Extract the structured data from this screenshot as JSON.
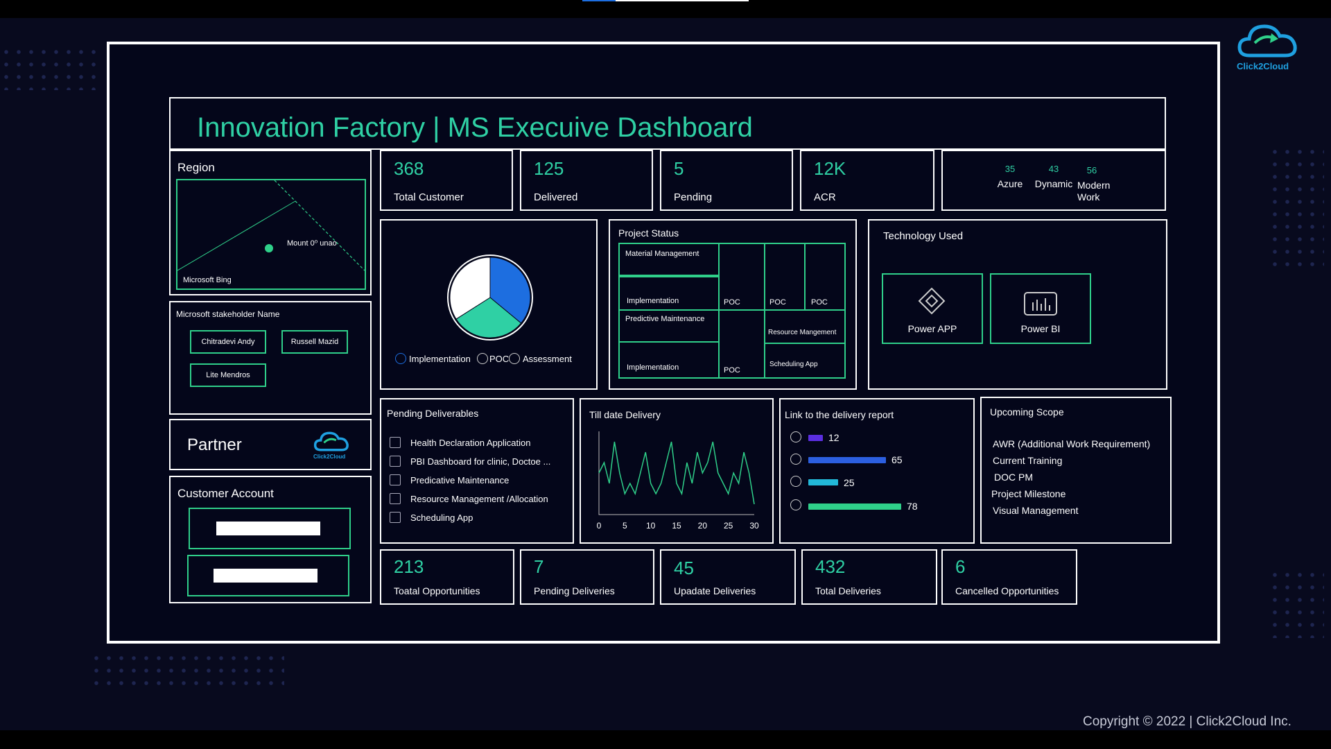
{
  "logo": {
    "text": "Click2Cloud"
  },
  "title": "Innovation Factory | MS Execuive Dashboard",
  "region": {
    "title": "Region",
    "marker_label": "Mount 0⁰ unao",
    "map_label": "Microsoft Bing"
  },
  "stakeholders": {
    "title": "Microsoft stakeholder Name",
    "names": [
      "Chitradevi Andy",
      "Russell Mazid",
      "Lite Mendros"
    ]
  },
  "partner": {
    "title": "Partner",
    "logo_text": "Click2Cloud"
  },
  "customer_account": {
    "title": "Customer Account"
  },
  "kpis_top": [
    {
      "value": "368",
      "label": "Total Customer"
    },
    {
      "value": "125",
      "label": "Delivered"
    },
    {
      "value": "5",
      "label": "Pending"
    },
    {
      "value": "12K",
      "label": "ACR"
    }
  ],
  "tech_counts": [
    {
      "value": "35",
      "label": "Azure"
    },
    {
      "value": "43",
      "label": "Dynamic"
    },
    {
      "value": "56",
      "label": "Modern Work"
    }
  ],
  "pie": {
    "legend": [
      "Implementation",
      "POC",
      "Assessment"
    ],
    "colors": [
      "#1d6ee0",
      "#2fd0a4",
      "#ffffff"
    ]
  },
  "project_status": {
    "title": "Project Status",
    "cells": {
      "material": "Material Management",
      "impl1": "Implementation",
      "poc1": "POC",
      "poc2": "POC",
      "poc3": "POC",
      "predictive": "Predictive Maintenance",
      "impl2": "Implementation",
      "poc4": "POC",
      "resource": "Resource Mangement",
      "scheduling": "Scheduling App"
    }
  },
  "technology": {
    "title": "Technology Used",
    "items": [
      "Power APP",
      "Power BI"
    ]
  },
  "pending_deliverables": {
    "title": "Pending Deliverables",
    "items": [
      "Health Declaration Application",
      "PBI Dashboard for clinic, Doctoe ...",
      "Predicative Maintenance",
      "Resource Management /Allocation",
      "Scheduling App"
    ]
  },
  "till_date": {
    "title": "Till date Delivery"
  },
  "delivery_report": {
    "title": "Link to the delivery report",
    "bars": [
      {
        "value": 12,
        "color": "#5b2ee0"
      },
      {
        "value": 65,
        "color": "#2c5fe0"
      },
      {
        "value": 25,
        "color": "#22b8d8"
      },
      {
        "value": 78,
        "color": "#2fd08a"
      }
    ]
  },
  "upcoming_scope": {
    "title": "Upcoming Scope",
    "items": [
      "AWR (Additional Work Requirement)",
      "Current Training",
      "DOC PM",
      "Project Milestone",
      "Visual Management"
    ]
  },
  "kpis_bottom": [
    {
      "value": "213",
      "label": "Toatal Opportunities"
    },
    {
      "value": "7",
      "label": "Pending Deliveries"
    },
    {
      "value": "45",
      "label": "Upadate Deliveries"
    },
    {
      "value": "432",
      "label": "Total Deliveries"
    },
    {
      "value": "6",
      "label": "Cancelled Opportunities"
    }
  ],
  "copyright": "Copyright © 2022 | Click2Cloud Inc.",
  "chart_data": {
    "type": "line",
    "x_ticks": [
      0,
      5,
      10,
      15,
      20,
      25,
      30
    ],
    "x": [
      0,
      1,
      2,
      3,
      4,
      5,
      6,
      7,
      8,
      9,
      10,
      11,
      12,
      13,
      14,
      15,
      16,
      17,
      18,
      19,
      20,
      21,
      22,
      23,
      24,
      25,
      26,
      27,
      28,
      29,
      30
    ],
    "y": [
      4,
      5,
      3,
      7,
      4,
      2,
      3,
      2,
      4,
      6,
      3,
      2,
      3,
      5,
      7,
      3,
      2,
      5,
      3,
      6,
      4,
      5,
      7,
      4,
      3,
      2,
      4,
      3,
      6,
      4,
      1
    ]
  }
}
